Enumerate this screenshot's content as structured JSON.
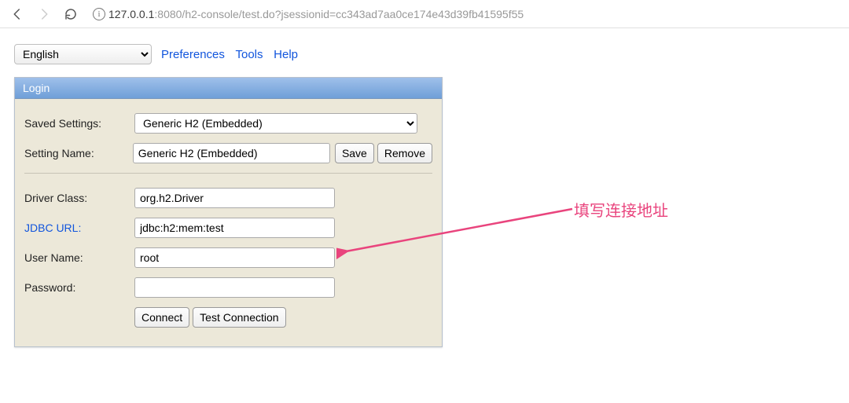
{
  "browser": {
    "url_prefix": "127.0.0.1",
    "url_suffix": ":8080/h2-console/test.do?jsessionid=cc343ad7aa0ce174e43d39fb41595f55"
  },
  "toolbar": {
    "language": "English",
    "preferences": "Preferences",
    "tools": "Tools",
    "help": "Help"
  },
  "panel": {
    "title": "Login",
    "saved_settings_label": "Saved Settings:",
    "saved_settings_value": "Generic H2 (Embedded)",
    "setting_name_label": "Setting Name:",
    "setting_name_value": "Generic H2 (Embedded)",
    "save_btn": "Save",
    "remove_btn": "Remove",
    "driver_label": "Driver Class:",
    "driver_value": "org.h2.Driver",
    "jdbc_label": "JDBC URL:",
    "jdbc_value": "jdbc:h2:mem:test",
    "user_label": "User Name:",
    "user_value": "root",
    "password_label": "Password:",
    "password_value": "",
    "connect_btn": "Connect",
    "test_btn": "Test Connection"
  },
  "annotation": {
    "text": "填写连接地址"
  }
}
